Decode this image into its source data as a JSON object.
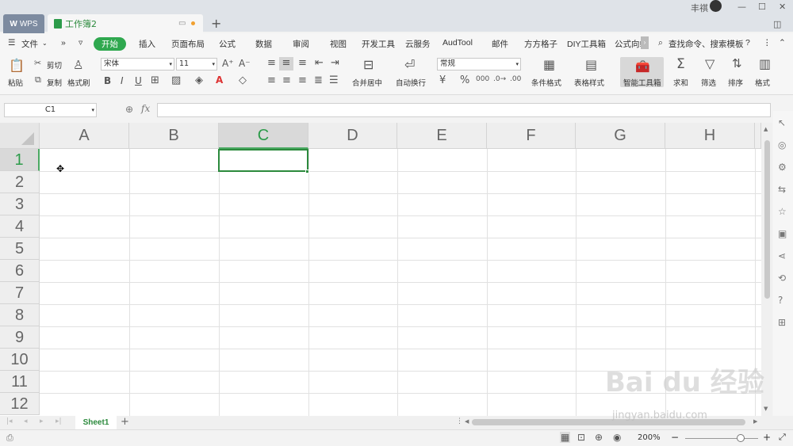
{
  "titlebar": {
    "wps_tab": "WPS",
    "doc_tab": "工作簿2",
    "user": "丰祺"
  },
  "menu": {
    "file": "文件",
    "start": "开始",
    "items": [
      "插入",
      "页面布局",
      "公式",
      "数据",
      "审阅",
      "视图",
      "开发工具",
      "云服务",
      "AudTool",
      "邮件",
      "方方格子",
      "DIY工具箱",
      "公式向!"
    ],
    "search": "查找命令、搜索模板"
  },
  "ribbon": {
    "paste": "粘贴",
    "cut": "剪切",
    "copy": "复制",
    "format_painter": "格式刷",
    "font_name": "宋体",
    "font_size": "11",
    "merge_center": "合并居中",
    "wrap_text": "自动换行",
    "number_format": "常规",
    "cond_format": "条件格式",
    "table_style": "表格样式",
    "smart_toolbox": "智能工具箱",
    "sum": "求和",
    "filter": "筛选",
    "sort": "排序",
    "format": "格式"
  },
  "formula": {
    "name_box": "C1",
    "fx": "fx",
    "value": ""
  },
  "grid": {
    "columns": [
      "A",
      "B",
      "C",
      "D",
      "E",
      "F",
      "G",
      "H"
    ],
    "rows": [
      "1",
      "2",
      "3",
      "4",
      "5",
      "6",
      "7",
      "8",
      "9",
      "10",
      "11",
      "12"
    ],
    "active_col": "C",
    "active_row": "1"
  },
  "sheets": {
    "tab": "Sheet1"
  },
  "status": {
    "zoom": "200%"
  },
  "watermark": {
    "brand": "Bai du 经验",
    "url": "jingyan.baidu.com"
  },
  "colors": {
    "accent": "#2fa84f",
    "active_cell": "#2c8a3d"
  }
}
